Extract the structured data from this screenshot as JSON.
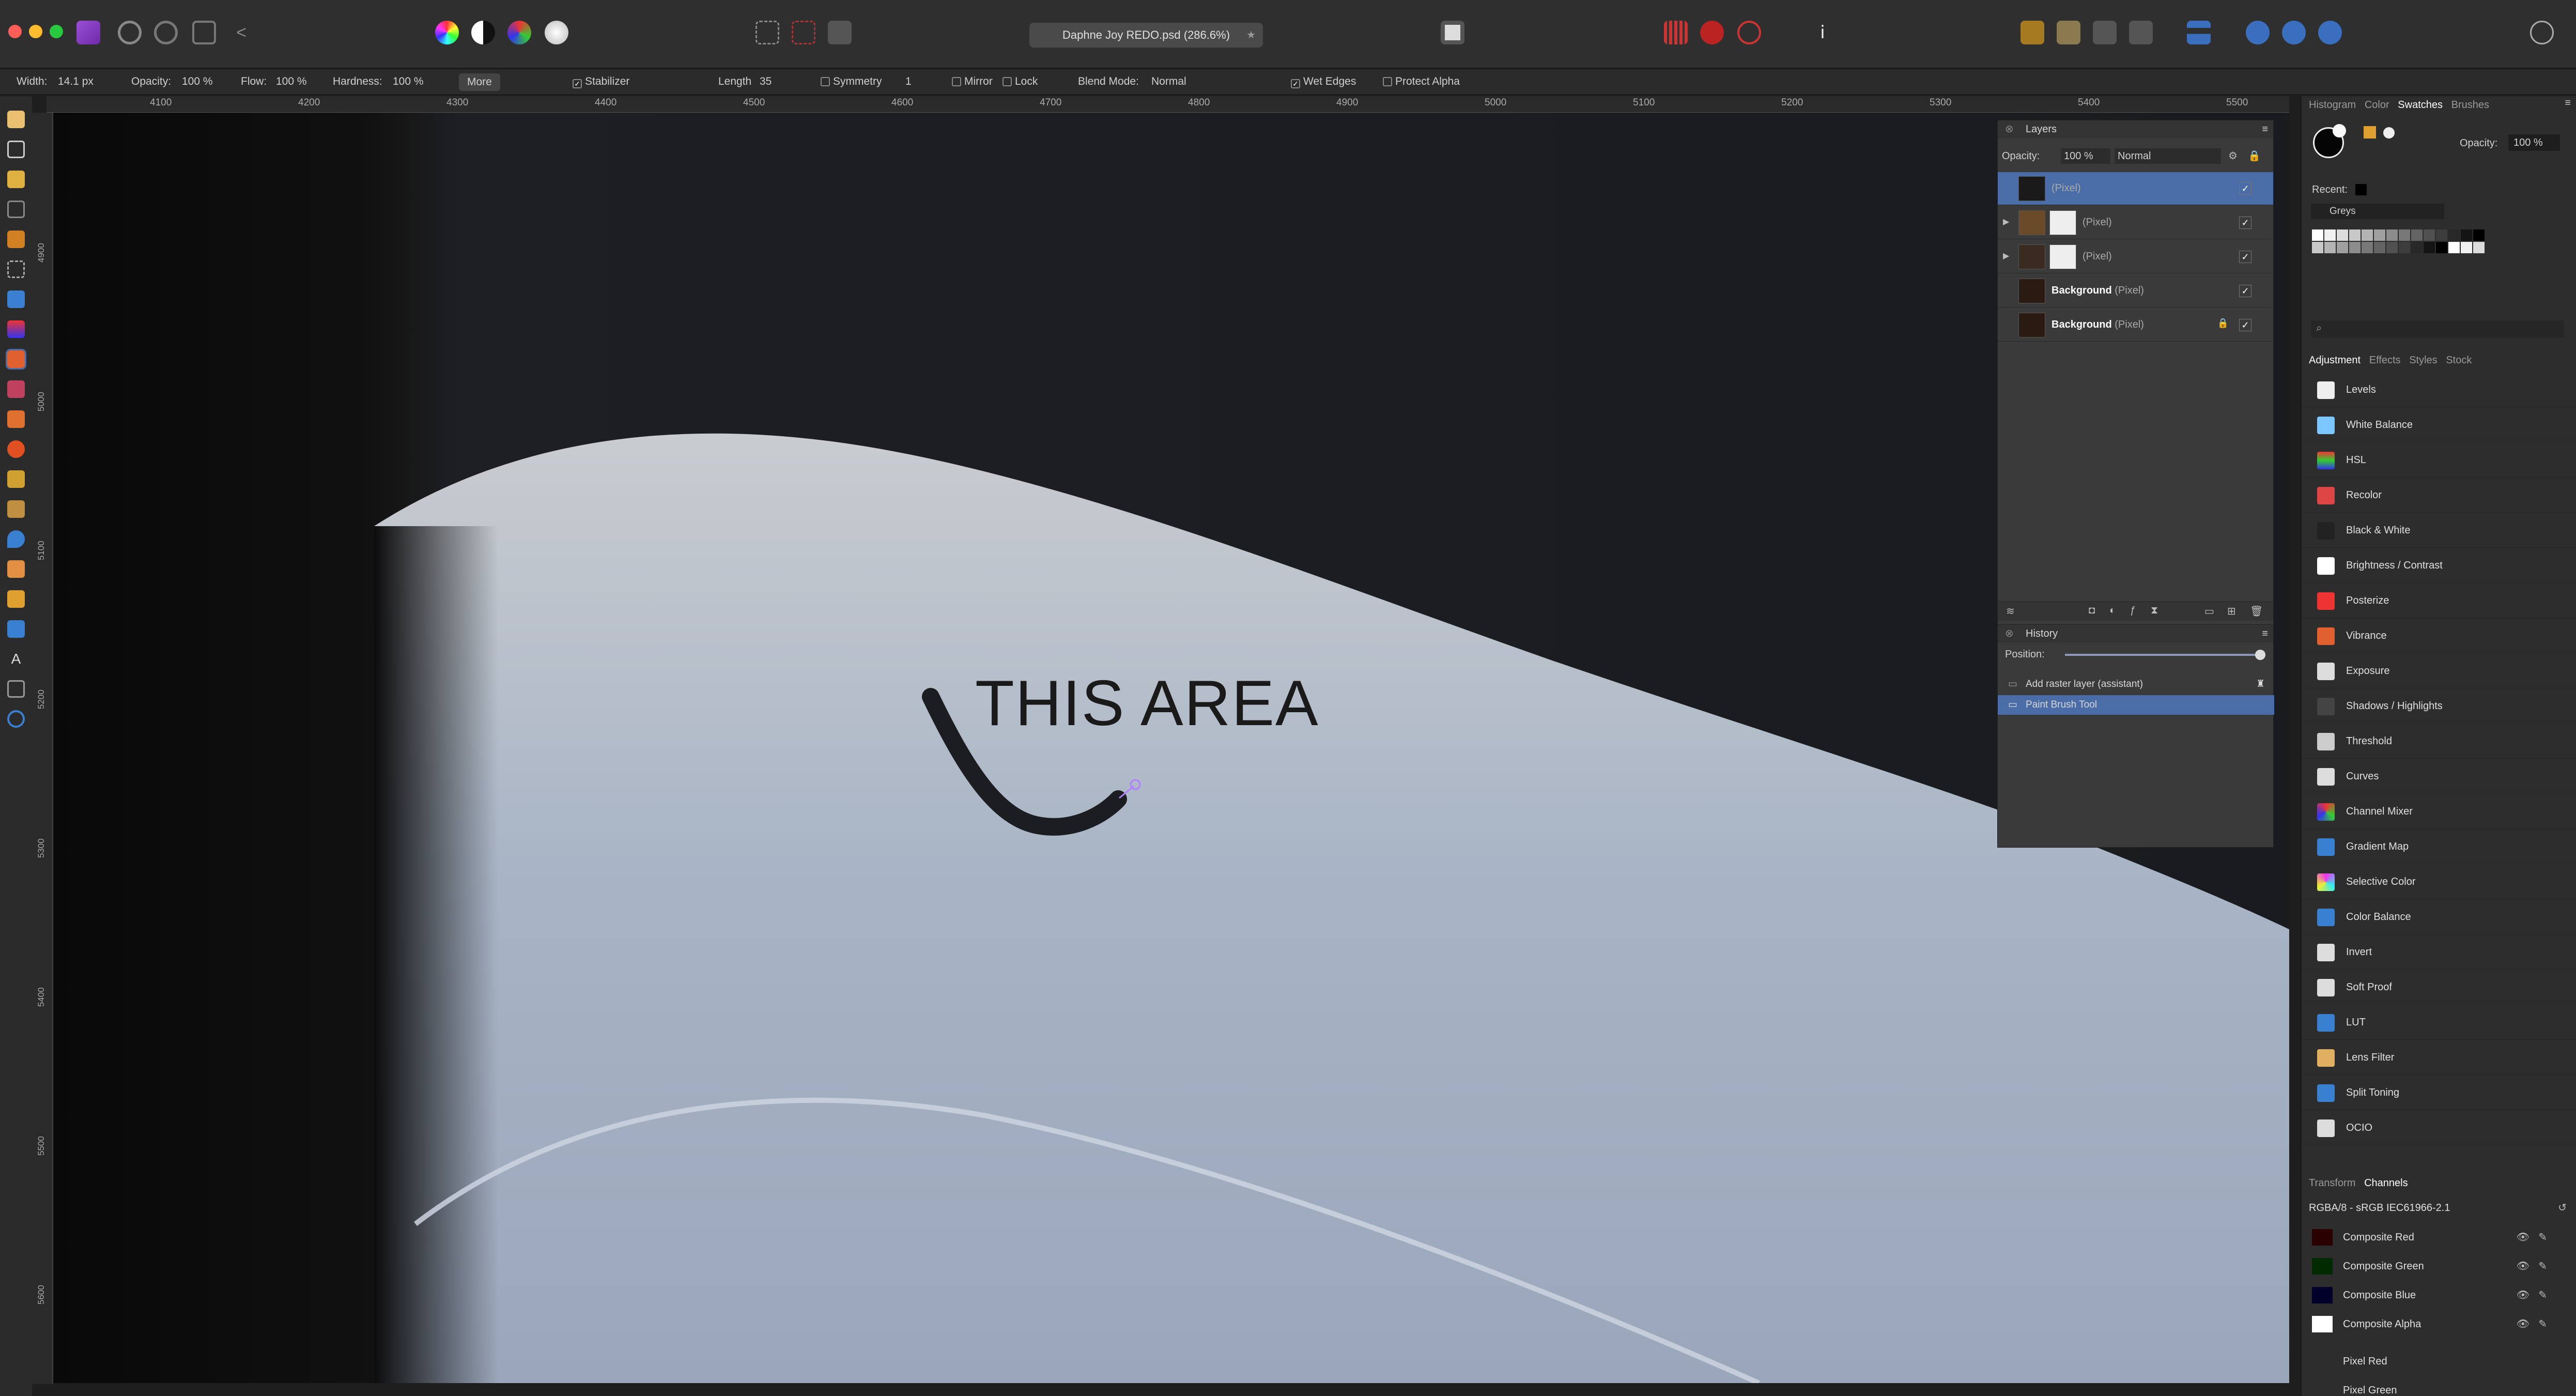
{
  "document": {
    "title": "Daphne Joy REDO.psd (286.6%)"
  },
  "context_toolbar": {
    "width_label": "Width:",
    "width_value": "14.1 px",
    "opacity_label": "Opacity:",
    "opacity_value": "100 %",
    "flow_label": "Flow:",
    "flow_value": "100 %",
    "hardness_label": "Hardness:",
    "hardness_value": "100 %",
    "more_button": "More",
    "stabilizer_label": "Stabilizer",
    "length_label": "Length",
    "length_value": "35",
    "symmetry_label": "Symmetry",
    "symmetry_value": "1",
    "mirror_label": "Mirror",
    "lock_label": "Lock",
    "blend_mode_label": "Blend Mode:",
    "blend_mode_value": "Normal",
    "wet_edges_label": "Wet Edges",
    "protect_alpha_label": "Protect Alpha"
  },
  "ruler": {
    "top_ticks": [
      "4100",
      "4200",
      "4300",
      "4400",
      "4500",
      "4600",
      "4700",
      "4800",
      "4900",
      "5000",
      "5100",
      "5200",
      "5300",
      "5400",
      "5500"
    ],
    "left_ticks": [
      "4900",
      "5000",
      "5100",
      "5200",
      "5300",
      "5400",
      "5500",
      "5600"
    ]
  },
  "canvas": {
    "annotation_text": "THIS AREA"
  },
  "layers_panel": {
    "title": "Layers",
    "opacity_label": "Opacity:",
    "opacity_value": "100 %",
    "blend_value": "Normal",
    "layers": [
      {
        "name": "",
        "type": "(Pixel)",
        "selected": true
      },
      {
        "name": "",
        "type": "(Pixel)",
        "selected": false
      },
      {
        "name": "",
        "type": "(Pixel)",
        "selected": false
      },
      {
        "name": "Background",
        "type": "(Pixel)",
        "selected": false
      },
      {
        "name": "Background",
        "type": "(Pixel)",
        "selected": false
      }
    ]
  },
  "history_panel": {
    "title": "History",
    "position_label": "Position:",
    "items": [
      "Add raster layer (assistant)",
      "Paint Brush Tool"
    ]
  },
  "top_tabs": [
    "Histogram",
    "Color",
    "Swatches",
    "Brushes"
  ],
  "swatches": {
    "opacity_label": "Opacity:",
    "opacity_value": "100 %",
    "recent_label": "Recent:",
    "palette_value": "Greys"
  },
  "adjustment_tabs": [
    "Adjustment",
    "Effects",
    "Styles",
    "Stock"
  ],
  "adjustments": [
    "Levels",
    "White Balance",
    "HSL",
    "Recolor",
    "Black & White",
    "Brightness / Contrast",
    "Posterize",
    "Vibrance",
    "Exposure",
    "Shadows / Highlights",
    "Threshold",
    "Curves",
    "Channel Mixer",
    "Gradient Map",
    "Selective Color",
    "Color Balance",
    "Invert",
    "Soft Proof",
    "LUT",
    "Lens Filter",
    "Split Toning",
    "OCIO"
  ],
  "bottom_tabs": [
    "Transform",
    "Channels"
  ],
  "channels": {
    "profile": "RGBA/8 - sRGB IEC61966-2.1",
    "rows": [
      "Composite Red",
      "Composite Green",
      "Composite Blue",
      "Composite Alpha"
    ],
    "pixel_rows": [
      "Pixel Red",
      "Pixel Green"
    ]
  },
  "colors": {
    "accent": "#4a6da8",
    "brush_stroke": "#1c1d20"
  }
}
